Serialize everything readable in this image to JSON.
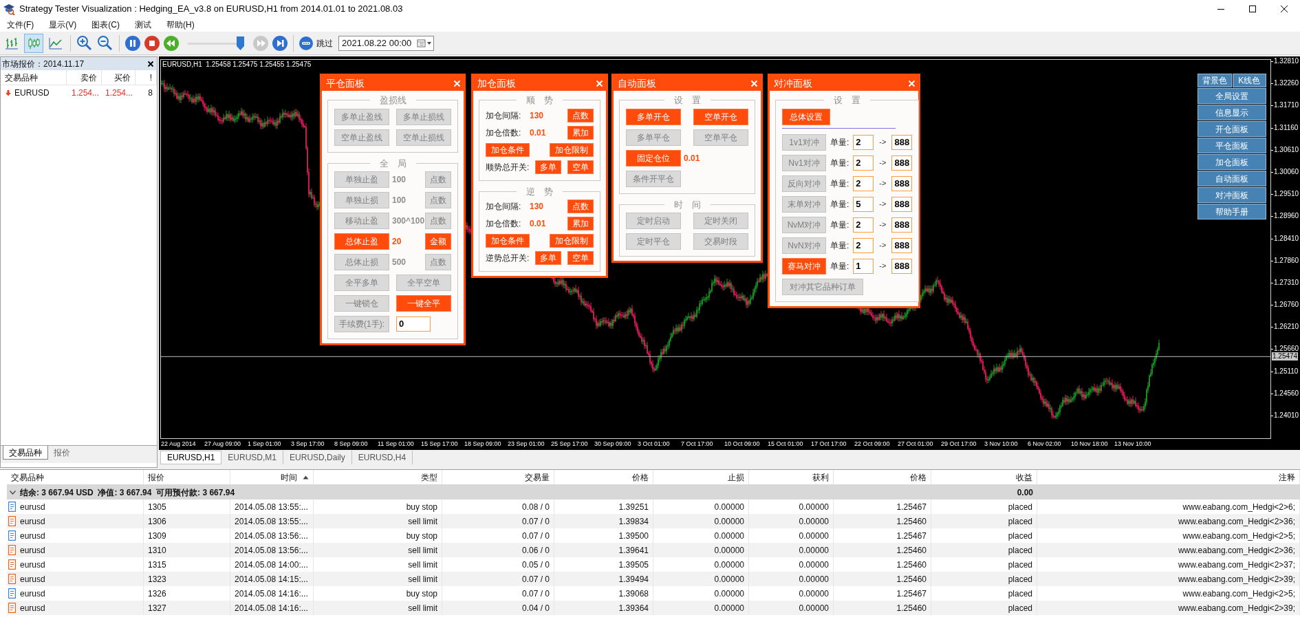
{
  "window": {
    "title": "Strategy Tester Visualization : Hedging_EA_v3.8 on EURUSD,H1 from 2014.01.01 to 2021.08.03"
  },
  "menu": [
    "文件(F)",
    "显示(V)",
    "图表(C)",
    "测试",
    "帮助(H)"
  ],
  "toolbar": {
    "chart_modes": [
      {
        "kind": "bars",
        "selected": false
      },
      {
        "kind": "candles",
        "selected": true
      },
      {
        "kind": "line",
        "selected": false
      }
    ],
    "playback": [
      {
        "kind": "pause",
        "disabled": false
      },
      {
        "kind": "stop",
        "disabled": false
      },
      {
        "kind": "rewind",
        "disabled": false
      }
    ],
    "speed": {
      "level": 0.93
    },
    "stepping": [
      {
        "kind": "fast-forward",
        "disabled": true
      },
      {
        "kind": "step-end",
        "disabled": false
      }
    ],
    "skip_label": "跳过",
    "skip_date": "2021.08.22 00:00"
  },
  "market_watch": {
    "title": "市场报价：2014.11.17",
    "columns": [
      "交易品种",
      "卖价",
      "买价",
      "!"
    ],
    "rows": [
      {
        "symbol": "EURUSD",
        "bid": "1.254...",
        "ask": "1.254...",
        "spread": "8",
        "down": true
      }
    ],
    "tabs": [
      {
        "label": "交易品种",
        "selected": true
      },
      {
        "label": "报价",
        "selected": false
      }
    ]
  },
  "chart": {
    "info": "EURUSD,H1  1.25458 1.25475 1.25455 1.25475",
    "price_ticks": [
      "1.32810",
      "1.32260",
      "1.31710",
      "1.31160",
      "1.30610",
      "1.30060",
      "1.29510",
      "1.28960",
      "1.28410",
      "1.27860",
      "1.27310",
      "1.26760",
      "1.26210",
      "1.25660",
      "1.25110",
      "1.24560",
      "1.24010"
    ],
    "current_price": "1.25474",
    "time_labels": [
      "22 Aug 2014",
      "27 Aug 09:00",
      "1 Sep 01:00",
      "3 Sep 17:00",
      "8 Sep 09:00",
      "11 Sep 01:00",
      "15 Sep 17:00",
      "18 Sep 09:00",
      "23 Sep 01:00",
      "25 Sep 17:00",
      "30 Sep 09:00",
      "3 Oct 01:00",
      "7 Oct 17:00",
      "10 Oct 09:00",
      "15 Oct 01:00",
      "17 Oct 17:00",
      "22 Oct 09:00",
      "27 Oct 01:00",
      "29 Oct 17:00",
      "3 Nov 10:00",
      "6 Nov 02:00",
      "10 Nov 18:00",
      "13 Nov 10:00"
    ],
    "tool_buttons": {
      "pair": [
        "背景色",
        "K线色"
      ],
      "list": [
        "全局设置",
        "信息显示",
        "开仓面板",
        "平仓面板",
        "加仓面板",
        "自动面板",
        "对冲面板",
        "帮助手册"
      ]
    },
    "panels": [
      {
        "kind": "close",
        "title": "平仓面板",
        "sections": [
          {
            "title": "盈损线",
            "rows": [
              {
                "items": [
                  {
                    "kind": "button",
                    "text": "多单止盈线",
                    "active": false
                  },
                  {
                    "kind": "button",
                    "text": "多单止损线",
                    "active": false
                  }
                ]
              },
              {
                "items": [
                  {
                    "kind": "button",
                    "text": "空单止盈线",
                    "active": false
                  },
                  {
                    "kind": "button",
                    "text": "空单止损线",
                    "active": false
                  }
                ]
              }
            ]
          },
          {
            "title": "全　局",
            "rows": [
              {
                "items": [
                  {
                    "kind": "button",
                    "text": "单独止盈",
                    "active": false
                  },
                  {
                    "kind": "value",
                    "text": "100",
                    "active": false
                  },
                  {
                    "kind": "short-button",
                    "text": "点数",
                    "active": false
                  }
                ]
              },
              {
                "items": [
                  {
                    "kind": "button",
                    "text": "单独止损",
                    "active": false
                  },
                  {
                    "kind": "value",
                    "text": "100",
                    "active": false
                  },
                  {
                    "kind": "short-button",
                    "text": "点数",
                    "active": false
                  }
                ]
              },
              {
                "items": [
                  {
                    "kind": "button",
                    "text": "移动止盈",
                    "active": false
                  },
                  {
                    "kind": "value",
                    "text": "300^100",
                    "active": false
                  },
                  {
                    "kind": "short-button",
                    "text": "点数",
                    "active": false
                  }
                ]
              },
              {
                "items": [
                  {
                    "kind": "button",
                    "text": "总体止盈",
                    "active": true
                  },
                  {
                    "kind": "value",
                    "text": "20",
                    "active": true
                  },
                  {
                    "kind": "short-button",
                    "text": "金额",
                    "active": true
                  }
                ]
              },
              {
                "items": [
                  {
                    "kind": "button",
                    "text": "总体止损",
                    "active": false
                  },
                  {
                    "kind": "value",
                    "text": "500",
                    "active": false
                  },
                  {
                    "kind": "short-button",
                    "text": "点数",
                    "active": false
                  }
                ]
              },
              {
                "items": [
                  {
                    "kind": "button",
                    "text": "全平多单",
                    "active": false
                  },
                  {
                    "kind": "button",
                    "text": "全平空单",
                    "active": false
                  }
                ]
              },
              {
                "items": [
                  {
                    "kind": "button",
                    "text": "一键锁仓",
                    "active": false
                  },
                  {
                    "kind": "button",
                    "text": "一键全平",
                    "active": true
                  }
                ]
              },
              {
                "items": [
                  {
                    "kind": "button",
                    "text": "手续费(1手):",
                    "active": false
                  },
                  {
                    "kind": "input",
                    "text": "0"
                  }
                ]
              }
            ]
          }
        ]
      },
      {
        "kind": "add",
        "title": "加仓面板",
        "sections": [
          {
            "title": "顺　势",
            "rows": [
              {
                "items": [
                  {
                    "kind": "label",
                    "text": "加仓间隔:"
                  },
                  {
                    "kind": "value",
                    "text": "130",
                    "active": true
                  },
                  {
                    "kind": "short-button",
                    "text": "点数",
                    "active": true
                  }
                ]
              },
              {
                "items": [
                  {
                    "kind": "label",
                    "text": "加仓倍数:"
                  },
                  {
                    "kind": "value",
                    "text": "0.01",
                    "active": true
                  },
                  {
                    "kind": "short-button",
                    "text": "累加",
                    "active": true
                  }
                ]
              },
              {
                "items": [
                  {
                    "kind": "button",
                    "text": "加仓条件",
                    "active": true
                  },
                  {
                    "kind": "button",
                    "text": "加仓限制",
                    "active": true
                  }
                ]
              },
              {
                "items": [
                  {
                    "kind": "label",
                    "text": "顺势总开关:"
                  },
                  {
                    "kind": "short-button",
                    "text": "多单",
                    "active": true
                  },
                  {
                    "kind": "short-button",
                    "text": "空单",
                    "active": true
                  }
                ]
              }
            ]
          },
          {
            "title": "逆　势",
            "rows": [
              {
                "items": [
                  {
                    "kind": "label",
                    "text": "加仓间隔:"
                  },
                  {
                    "kind": "value",
                    "text": "130",
                    "active": true
                  },
                  {
                    "kind": "short-button",
                    "text": "点数",
                    "active": true
                  }
                ]
              },
              {
                "items": [
                  {
                    "kind": "label",
                    "text": "加仓倍数:"
                  },
                  {
                    "kind": "value",
                    "text": "0.01",
                    "active": true
                  },
                  {
                    "kind": "short-button",
                    "text": "累加",
                    "active": true
                  }
                ]
              },
              {
                "items": [
                  {
                    "kind": "button",
                    "text": "加仓条件",
                    "active": true
                  },
                  {
                    "kind": "button",
                    "text": "加仓限制",
                    "active": true
                  }
                ]
              },
              {
                "items": [
                  {
                    "kind": "label",
                    "text": "逆势总开关:"
                  },
                  {
                    "kind": "short-button",
                    "text": "多单",
                    "active": true
                  },
                  {
                    "kind": "short-button",
                    "text": "空单",
                    "active": true
                  }
                ]
              }
            ]
          }
        ]
      },
      {
        "kind": "auto",
        "title": "自动面板",
        "sections": [
          {
            "title": "设　置",
            "rows": [
              {
                "items": [
                  {
                    "kind": "button",
                    "text": "多单开仓",
                    "active": true
                  },
                  {
                    "kind": "button",
                    "text": "空单开仓",
                    "active": true
                  }
                ]
              },
              {
                "items": [
                  {
                    "kind": "button",
                    "text": "多单平仓",
                    "active": false
                  },
                  {
                    "kind": "button",
                    "text": "空单平仓",
                    "active": false
                  }
                ]
              },
              {
                "items": [
                  {
                    "kind": "button",
                    "text": "固定仓位",
                    "active": true
                  },
                  {
                    "kind": "value",
                    "text": "0.01",
                    "active": true
                  }
                ]
              },
              {
                "items": [
                  {
                    "kind": "button",
                    "text": "条件开平仓",
                    "active": false
                  }
                ]
              }
            ]
          },
          {
            "title": "时　间",
            "rows": [
              {
                "items": [
                  {
                    "kind": "button",
                    "text": "定时启动",
                    "active": false
                  },
                  {
                    "kind": "button",
                    "text": "定时关闭",
                    "active": false
                  }
                ]
              },
              {
                "items": [
                  {
                    "kind": "button",
                    "text": "定时平仓",
                    "active": false
                  },
                  {
                    "kind": "button",
                    "text": "交易时段",
                    "active": false
                  }
                ]
              }
            ]
          }
        ]
      },
      {
        "kind": "hedge",
        "title": "对冲面板",
        "sections": [
          {
            "title": "设　置",
            "rows": [
              {
                "items": [
                  {
                    "kind": "wide-button",
                    "text": "总体设置",
                    "active": true
                  }
                ]
              },
              {
                "kind": "divider"
              },
              {
                "items": [
                  {
                    "kind": "button",
                    "text": "1v1对冲",
                    "active": false
                  },
                  {
                    "kind": "label",
                    "text": "单量:"
                  },
                  {
                    "kind": "input",
                    "text": "2"
                  },
                  {
                    "kind": "arrow",
                    "text": "->"
                  },
                  {
                    "kind": "input",
                    "text": "888"
                  }
                ]
              },
              {
                "items": [
                  {
                    "kind": "button",
                    "text": "Nv1对冲",
                    "active": false
                  },
                  {
                    "kind": "label",
                    "text": "单量:"
                  },
                  {
                    "kind": "input",
                    "text": "2"
                  },
                  {
                    "kind": "arrow",
                    "text": "->"
                  },
                  {
                    "kind": "input",
                    "text": "888"
                  }
                ]
              },
              {
                "items": [
                  {
                    "kind": "button",
                    "text": "反向对冲",
                    "active": false
                  },
                  {
                    "kind": "label",
                    "text": "单量:"
                  },
                  {
                    "kind": "input",
                    "text": "2"
                  },
                  {
                    "kind": "arrow",
                    "text": "->"
                  },
                  {
                    "kind": "input",
                    "text": "888"
                  }
                ]
              },
              {
                "items": [
                  {
                    "kind": "button",
                    "text": "末单对冲",
                    "active": false
                  },
                  {
                    "kind": "label",
                    "text": "单量:"
                  },
                  {
                    "kind": "input",
                    "text": "5"
                  },
                  {
                    "kind": "arrow",
                    "text": "->"
                  },
                  {
                    "kind": "input",
                    "text": "888"
                  }
                ]
              },
              {
                "items": [
                  {
                    "kind": "button",
                    "text": "NvM对冲",
                    "active": false
                  },
                  {
                    "kind": "label",
                    "text": "单量:"
                  },
                  {
                    "kind": "input",
                    "text": "2"
                  },
                  {
                    "kind": "arrow",
                    "text": "->"
                  },
                  {
                    "kind": "input",
                    "text": "888"
                  }
                ]
              },
              {
                "items": [
                  {
                    "kind": "button",
                    "text": "NvN对冲",
                    "active": false
                  },
                  {
                    "kind": "label",
                    "text": "单量:"
                  },
                  {
                    "kind": "input",
                    "text": "2"
                  },
                  {
                    "kind": "arrow",
                    "text": "->"
                  },
                  {
                    "kind": "input",
                    "text": "888"
                  }
                ]
              },
              {
                "items": [
                  {
                    "kind": "button",
                    "text": "赛马对冲",
                    "active": true
                  },
                  {
                    "kind": "label",
                    "text": "单量:"
                  },
                  {
                    "kind": "input",
                    "text": "1"
                  },
                  {
                    "kind": "arrow",
                    "text": "->"
                  },
                  {
                    "kind": "input",
                    "text": "888"
                  }
                ]
              },
              {
                "items": [
                  {
                    "kind": "long-button",
                    "text": "对冲其它品种订单",
                    "active": false
                  }
                ]
              }
            ]
          }
        ]
      }
    ],
    "tabs": [
      {
        "label": "EURUSD,H1",
        "selected": true
      },
      {
        "label": "EURUSD,M1",
        "selected": false
      },
      {
        "label": "EURUSD,Daily",
        "selected": false
      },
      {
        "label": "EURUSD,H4",
        "selected": false
      }
    ]
  },
  "table": {
    "columns": [
      {
        "label": "交易品种",
        "sorted": false
      },
      {
        "label": "报价",
        "sorted": false
      },
      {
        "label": "时间",
        "sorted": true
      },
      {
        "label": "类型",
        "sorted": false
      },
      {
        "label": "交易量",
        "sorted": false
      },
      {
        "label": "价格",
        "sorted": false
      },
      {
        "label": "止损",
        "sorted": false
      },
      {
        "label": "获利",
        "sorted": false
      },
      {
        "label": "价格",
        "sorted": false
      },
      {
        "label": "收益",
        "sorted": false
      },
      {
        "label": "注释",
        "sorted": false
      }
    ],
    "summary": {
      "text": "结余: 3 667.94 USD  净值: 3 667.94  可用预付款: 3 667.94",
      "profit": "0.00",
      "expanded": true
    },
    "rows": [
      {
        "color": "#3c82d8",
        "cells": [
          "eurusd",
          "1305",
          "2014.05.08 13:55:...",
          "buy stop",
          "0.08 / 0",
          "1.39251",
          "0.00000",
          "0.00000",
          "1.25467",
          "placed",
          "www.eabang.com_Hedgi<2>6;"
        ]
      },
      {
        "color": "#e8641c",
        "cells": [
          "eurusd",
          "1306",
          "2014.05.08 13:55:...",
          "sell limit",
          "0.07 / 0",
          "1.39834",
          "0.00000",
          "0.00000",
          "1.25460",
          "placed",
          "www.eabang.com_Hedgi<2>36;"
        ]
      },
      {
        "color": "#3c82d8",
        "cells": [
          "eurusd",
          "1309",
          "2014.05.08 13:56:...",
          "buy stop",
          "0.07 / 0",
          "1.39500",
          "0.00000",
          "0.00000",
          "1.25467",
          "placed",
          "www.eabang.com_Hedgi<2>5;"
        ]
      },
      {
        "color": "#e8641c",
        "cells": [
          "eurusd",
          "1310",
          "2014.05.08 13:56:...",
          "sell limit",
          "0.06 / 0",
          "1.39641",
          "0.00000",
          "0.00000",
          "1.25460",
          "placed",
          "www.eabang.com_Hedgi<2>36;"
        ]
      },
      {
        "color": "#e8641c",
        "cells": [
          "eurusd",
          "1315",
          "2014.05.08 14:00:...",
          "sell limit",
          "0.05 / 0",
          "1.39505",
          "0.00000",
          "0.00000",
          "1.25460",
          "placed",
          "www.eabang.com_Hedgi<2>37;"
        ]
      },
      {
        "color": "#e8641c",
        "cells": [
          "eurusd",
          "1323",
          "2014.05.08 14:15:...",
          "sell limit",
          "0.07 / 0",
          "1.39494",
          "0.00000",
          "0.00000",
          "1.25460",
          "placed",
          "www.eabang.com_Hedgi<2>39;"
        ]
      },
      {
        "color": "#3c82d8",
        "cells": [
          "eurusd",
          "1326",
          "2014.05.08 14:16:...",
          "buy stop",
          "0.07 / 0",
          "1.39068",
          "0.00000",
          "0.00000",
          "1.25467",
          "placed",
          "www.eabang.com_Hedgi<2>5;"
        ]
      },
      {
        "color": "#e8641c",
        "cells": [
          "eurusd",
          "1327",
          "2014.05.08 14:16:...",
          "sell limit",
          "0.04 / 0",
          "1.39364",
          "0.00000",
          "0.00000",
          "1.25460",
          "placed",
          "www.eabang.com_Hedgi<2>39;"
        ]
      }
    ]
  }
}
